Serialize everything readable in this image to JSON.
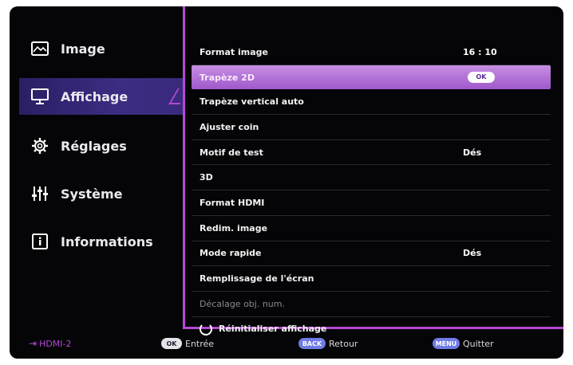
{
  "sidebar": {
    "items": [
      {
        "label": "Image",
        "icon": "image-icon"
      },
      {
        "label": "Affichage",
        "icon": "monitor-icon",
        "active": true
      },
      {
        "label": "Réglages",
        "icon": "gear-icon"
      },
      {
        "label": "Système",
        "icon": "sliders-icon"
      },
      {
        "label": "Informations",
        "icon": "info-icon"
      }
    ]
  },
  "panel": {
    "rows": [
      {
        "label": "Format image",
        "value": "16 : 10"
      },
      {
        "label": "Trapèze 2D",
        "value": "OK"
      },
      {
        "label": "Trapèze vertical auto",
        "value": ""
      },
      {
        "label": "Ajuster coin",
        "value": ""
      },
      {
        "label": "Motif de test",
        "value": "Dés"
      },
      {
        "label": "3D",
        "value": ""
      },
      {
        "label": "Format HDMI",
        "value": ""
      },
      {
        "label": "Redim. image",
        "value": ""
      },
      {
        "label": "Mode rapide",
        "value": "Dés"
      },
      {
        "label": "Remplissage de l'écran",
        "value": ""
      },
      {
        "label": "Décalage obj. num.",
        "value": ""
      },
      {
        "label": "Réinitialiser affichage",
        "value": ""
      }
    ]
  },
  "footer": {
    "source": "HDMI-2",
    "ok_btn": "OK",
    "ok_label": "Entrée",
    "back_btn": "BACK",
    "back_label": "Retour",
    "menu_btn": "MENU",
    "menu_label": "Quitter"
  },
  "colors": {
    "accent": "#b548d4",
    "selection": "#a058cc",
    "active_menu": "#3c2c82",
    "button_blue": "#6f7ce6"
  }
}
